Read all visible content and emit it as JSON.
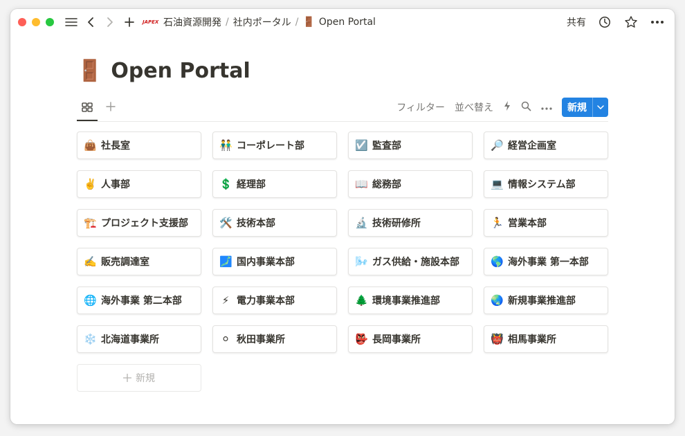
{
  "breadcrumb": {
    "logo_text": "JAPEX",
    "items": [
      "石油資源開発",
      "社内ポータル",
      "Open Portal"
    ],
    "current_icon": "🚪"
  },
  "topbar": {
    "share_label": "共有"
  },
  "page": {
    "title": "Open Portal",
    "icon": "🚪"
  },
  "toolbar": {
    "filter_label": "フィルター",
    "sort_label": "並べ替え",
    "new_label": "新規"
  },
  "cards": [
    {
      "icon": "👜",
      "label": "社長室"
    },
    {
      "icon": "👬",
      "label": "コーポレート部"
    },
    {
      "icon": "☑️",
      "label": "監査部"
    },
    {
      "icon": "🔎",
      "label": "経営企画室"
    },
    {
      "icon": "✌️",
      "label": "人事部"
    },
    {
      "icon": "💲",
      "label": "経理部"
    },
    {
      "icon": "📖",
      "label": "総務部"
    },
    {
      "icon": "💻",
      "label": "情報システム部"
    },
    {
      "icon": "🏗️",
      "label": "プロジェクト支援部"
    },
    {
      "icon": "🛠️",
      "label": "技術本部"
    },
    {
      "icon": "🔬",
      "label": "技術研修所"
    },
    {
      "icon": "🏃",
      "label": "営業本部"
    },
    {
      "icon": "✍️",
      "label": "販売調達室"
    },
    {
      "icon": "🗾",
      "label": "国内事業本部"
    },
    {
      "icon": "🌬️",
      "label": "ガス供給・施設本部"
    },
    {
      "icon": "🌎",
      "label": "海外事業 第一本部"
    },
    {
      "icon": "🌐",
      "label": "海外事業 第二本部"
    },
    {
      "icon": "⚡",
      "label": "電力事業本部"
    },
    {
      "icon": "🌲",
      "label": "環境事業推進部"
    },
    {
      "icon": "🌏",
      "label": "新規事業推進部"
    },
    {
      "icon": "❄️",
      "label": "北海道事業所"
    },
    {
      "icon": "⚪",
      "label": "秋田事業所"
    },
    {
      "icon": "👺",
      "label": "長岡事業所"
    },
    {
      "icon": "👹",
      "label": "相馬事業所"
    }
  ],
  "add_card_label": "新規"
}
